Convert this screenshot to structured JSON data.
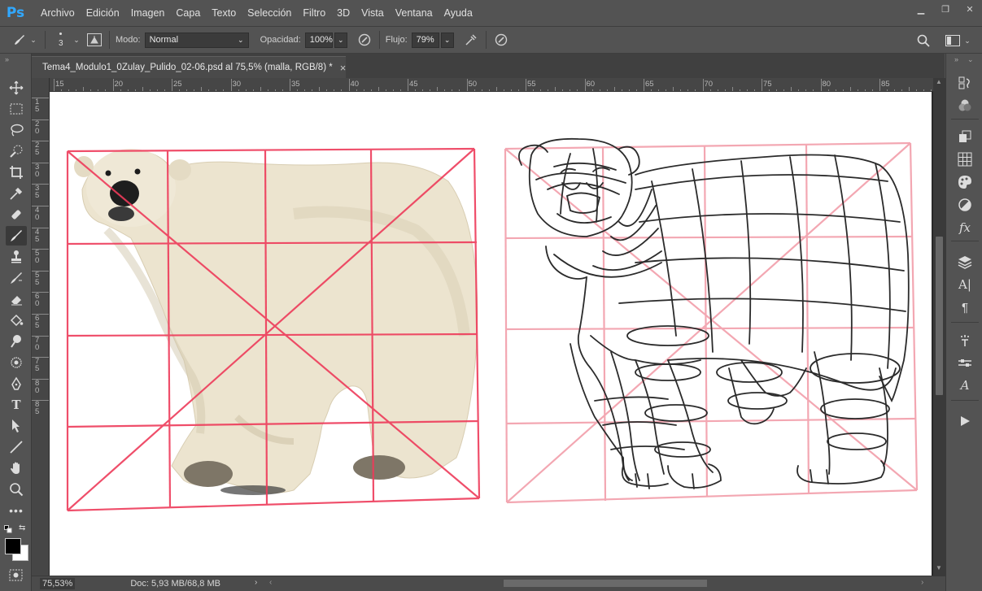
{
  "app": {
    "logo": "Ps"
  },
  "menu": [
    "Archivo",
    "Edición",
    "Imagen",
    "Capa",
    "Texto",
    "Selección",
    "Filtro",
    "3D",
    "Vista",
    "Ventana",
    "Ayuda"
  ],
  "window_controls": {
    "minimize": "▁",
    "restore": "❐",
    "close": "✕"
  },
  "options": {
    "brush_size": "3",
    "mode_label": "Modo:",
    "mode_value": "Normal",
    "opacity_label": "Opacidad:",
    "opacity_value": "100%",
    "flow_label": "Flujo:",
    "flow_value": "79%"
  },
  "document_tab": {
    "title": "Tema4_Modulo1_0Zulay_Pulido_02-06.psd al 75,5% (malla, RGB/8) *",
    "close": "×"
  },
  "ruler_top_labels": [
    "15",
    "20",
    "25",
    "30",
    "35",
    "40",
    "45",
    "50",
    "55",
    "60",
    "65",
    "70",
    "75",
    "80",
    "85"
  ],
  "ruler_left_labels": [
    "1 5",
    "2 0",
    "2 5",
    "3 0",
    "3 5",
    "4 0",
    "4 5",
    "5 0",
    "5 5",
    "6 0",
    "6 5",
    "7 0",
    "7 5",
    "8 0",
    "8 5"
  ],
  "status": {
    "zoom": "75,53%",
    "doc": "Doc: 5,93 MB/68,8 MB"
  },
  "colors": {
    "ui_bg": "#535353",
    "canvas_bg": "#282828",
    "grid_pink": "#ee3b5a",
    "sketch_pink": "#f3a7b2",
    "ps_blue": "#31a8ff"
  }
}
